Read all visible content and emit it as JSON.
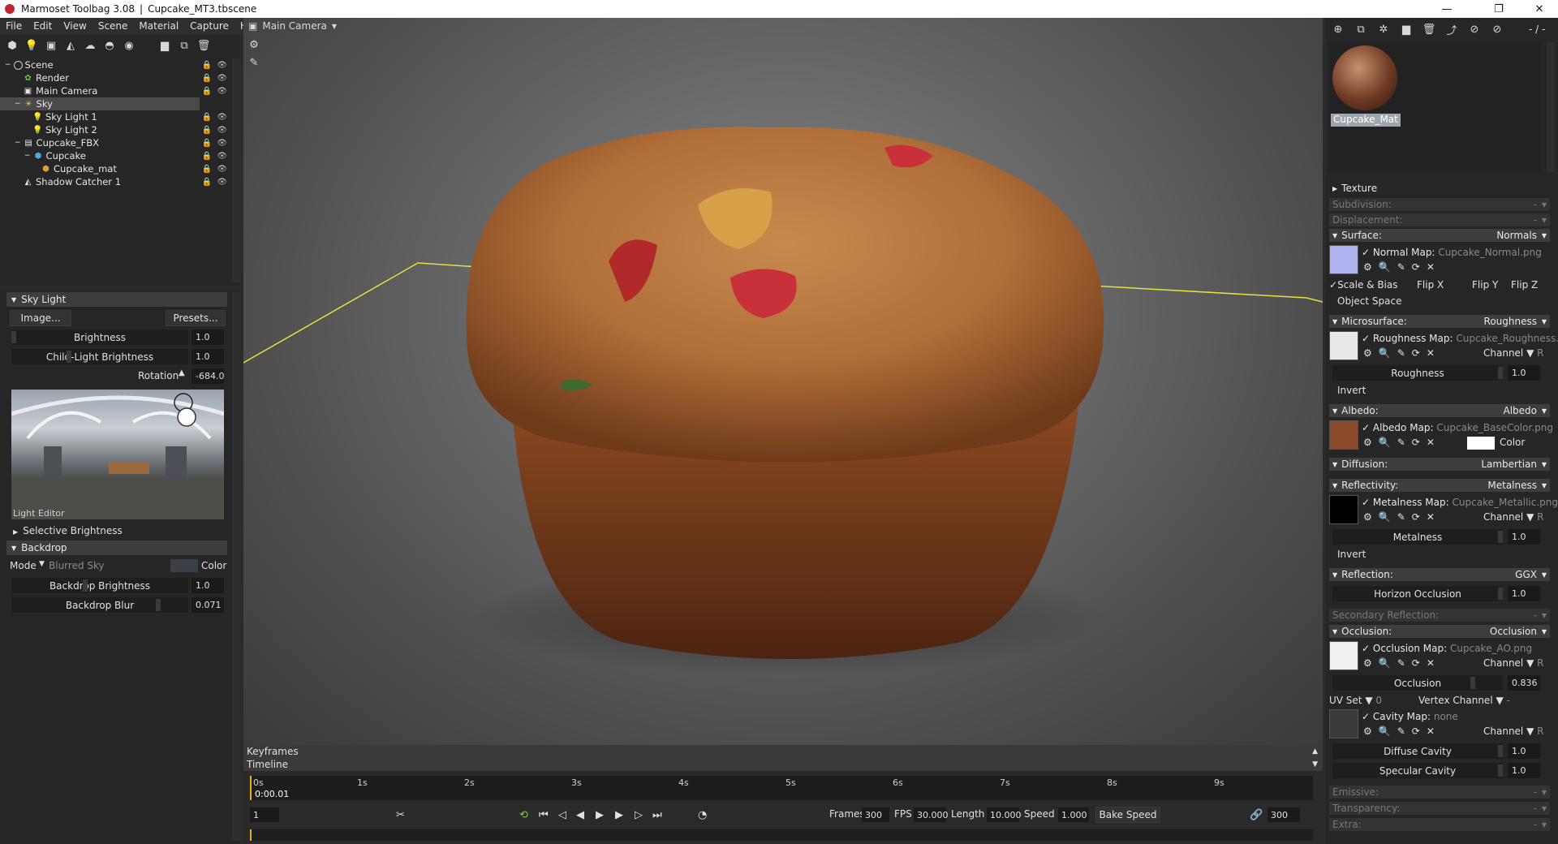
{
  "titlebar": {
    "app": "Marmoset Toolbag 3.08",
    "sep": "|",
    "file": "Cupcake_MT3.tbscene",
    "minimize": "—",
    "restore": "❐",
    "close": "✕"
  },
  "menu": [
    "File",
    "Edit",
    "View",
    "Scene",
    "Material",
    "Capture",
    "Help"
  ],
  "scene_tree": [
    {
      "label": "Scene",
      "icon": "scene-icon"
    },
    {
      "label": "Render",
      "icon": "render-icon"
    },
    {
      "label": "Main Camera",
      "icon": "camera-icon"
    },
    {
      "label": "Sky",
      "icon": "sky-icon"
    },
    {
      "label": "Sky Light 1",
      "icon": "light-icon"
    },
    {
      "label": "Sky Light 2",
      "icon": "light-icon"
    },
    {
      "label": "Cupcake_FBX",
      "icon": "fbx-icon"
    },
    {
      "label": "Cupcake",
      "icon": "mesh-icon"
    },
    {
      "label": "Cupcake_mat",
      "icon": "material-icon"
    },
    {
      "label": "Shadow Catcher 1",
      "icon": "shadow-catcher-icon"
    }
  ],
  "sky_light": {
    "header": "Sky Light",
    "image_btn": "Image...",
    "presets_btn": "Presets...",
    "brightness_label": "Brightness",
    "brightness": "1.0",
    "child_label": "Child-Light Brightness",
    "child": "1.0",
    "rotation_label": "Rotation",
    "rotation": "-684.0",
    "editor_label": "Light Editor",
    "selective": "Selective Brightness"
  },
  "backdrop": {
    "header": "Backdrop",
    "mode_label": "Mode",
    "mode_value": "Blurred Sky",
    "color_label": "Color",
    "brightness_label": "Backdrop Brightness",
    "brightness": "1.0",
    "blur_label": "Backdrop Blur",
    "blur": "0.071"
  },
  "viewport": {
    "camera": "Main Camera"
  },
  "timeline": {
    "keyframes": "Keyframes",
    "timeline": "Timeline",
    "ticks": [
      "0s",
      "1s",
      "2s",
      "3s",
      "4s",
      "5s",
      "6s",
      "7s",
      "8s",
      "9s"
    ],
    "current_time": "0:00.01",
    "frame": "1",
    "frames_label": "Frames",
    "frames": "300",
    "fps_label": "FPS",
    "fps": "30.000",
    "length_label": "Length",
    "length": "10.000",
    "speed_label": "Speed",
    "speed": "1.000",
    "bake_speed": "Bake Speed",
    "end_frame": "300"
  },
  "material": {
    "name": "Cupcake_Mat",
    "top_right": "- / -",
    "texture": "Texture",
    "subdivision": "Subdivision:",
    "subdivision_val": "-",
    "displacement": "Displacement:",
    "displacement_val": "-",
    "surface": "Surface:",
    "surface_val": "Normals",
    "normal_map": "Normal Map:",
    "normal_file": "Cupcake_Normal.png",
    "scale_bias": "Scale & Bias",
    "flip_x": "Flip X",
    "flip_y": "Flip Y",
    "flip_z": "Flip Z",
    "object_space": "Object Space",
    "microsurface": "Microsurface:",
    "microsurface_val": "Roughness",
    "roughness_map": "Roughness Map:",
    "roughness_file": "Cupcake_Roughness.png",
    "channel": "Channel",
    "channel_r": "R",
    "roughness": "Roughness",
    "roughness_val": "1.0",
    "invert": "Invert",
    "albedo": "Albedo:",
    "albedo_val": "Albedo",
    "albedo_map": "Albedo Map:",
    "albedo_file": "Cupcake_BaseColor.png",
    "color": "Color",
    "diffusion": "Diffusion:",
    "diffusion_val": "Lambertian",
    "reflectivity": "Reflectivity:",
    "reflectivity_val": "Metalness",
    "metal_map": "Metalness Map:",
    "metal_file": "Cupcake_Metallic.png",
    "metalness": "Metalness",
    "metalness_val": "1.0",
    "reflection": "Reflection:",
    "reflection_val": "GGX",
    "horizon": "Horizon Occlusion",
    "horizon_val": "1.0",
    "secondary": "Secondary Reflection:",
    "secondary_val": "-",
    "occlusion": "Occlusion:",
    "occlusion_val": "Occlusion",
    "occ_map": "Occlusion Map:",
    "occ_file": "Cupcake_AO.png",
    "occlusion_slider": "Occlusion",
    "occlusion_slider_val": "0.836",
    "uv_set": "UV Set",
    "uv_val": "0",
    "vertex_channel": "Vertex Channel",
    "vertex_val": "-",
    "cavity_map": "Cavity Map:",
    "cavity_file": "none",
    "diffuse_cavity": "Diffuse Cavity",
    "diffuse_cavity_val": "1.0",
    "specular_cavity": "Specular Cavity",
    "specular_cavity_val": "1.0",
    "emissive": "Emissive:",
    "emissive_val": "-",
    "transparency": "Transparency:",
    "transparency_val": "-",
    "extra": "Extra:",
    "extra_val": "-"
  }
}
